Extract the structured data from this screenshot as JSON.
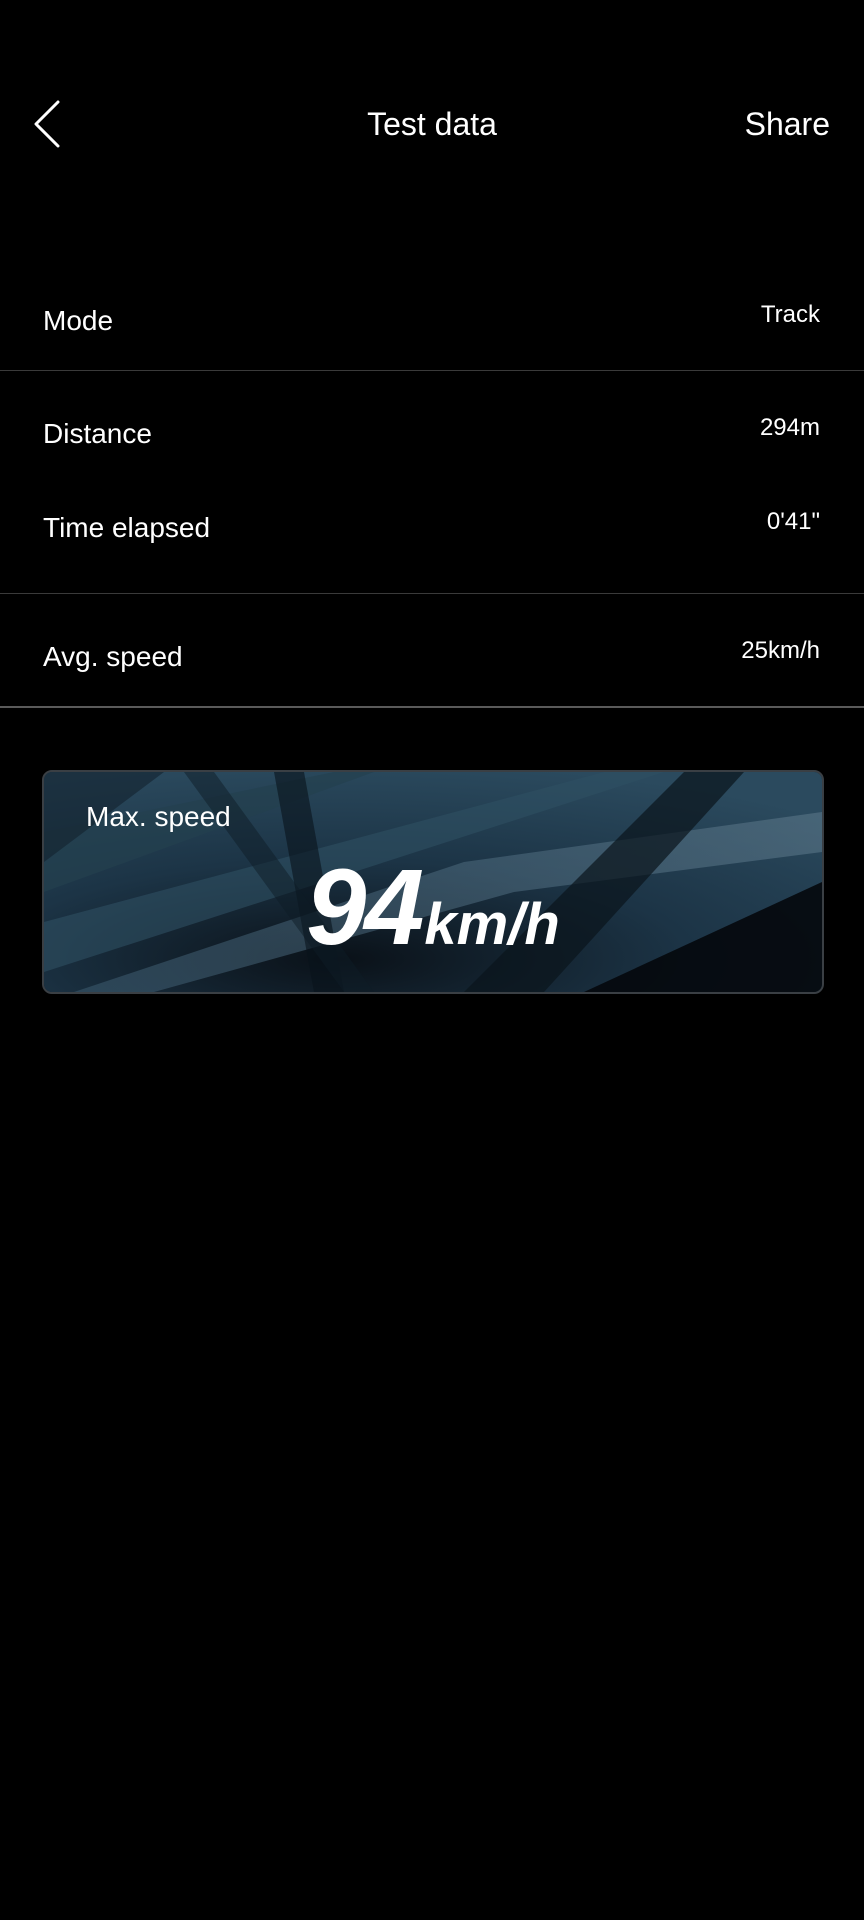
{
  "header": {
    "title": "Test data",
    "share_label": "Share",
    "back_icon": "chevron-left-icon"
  },
  "rows": [
    {
      "label": "Mode",
      "value": "Track"
    },
    {
      "label": "Distance",
      "value": "294m"
    },
    {
      "label": "Time elapsed",
      "value": "0'41\""
    },
    {
      "label": "Avg. speed",
      "value": "25km/h"
    }
  ],
  "max_speed": {
    "label": "Max. speed",
    "value": "94",
    "unit": "km/h"
  },
  "colors": {
    "background": "#000000",
    "text": "#ffffff",
    "card_base": "#0b1620",
    "card_accent": "#2f4a5c",
    "divider": "#3a3a3a"
  }
}
